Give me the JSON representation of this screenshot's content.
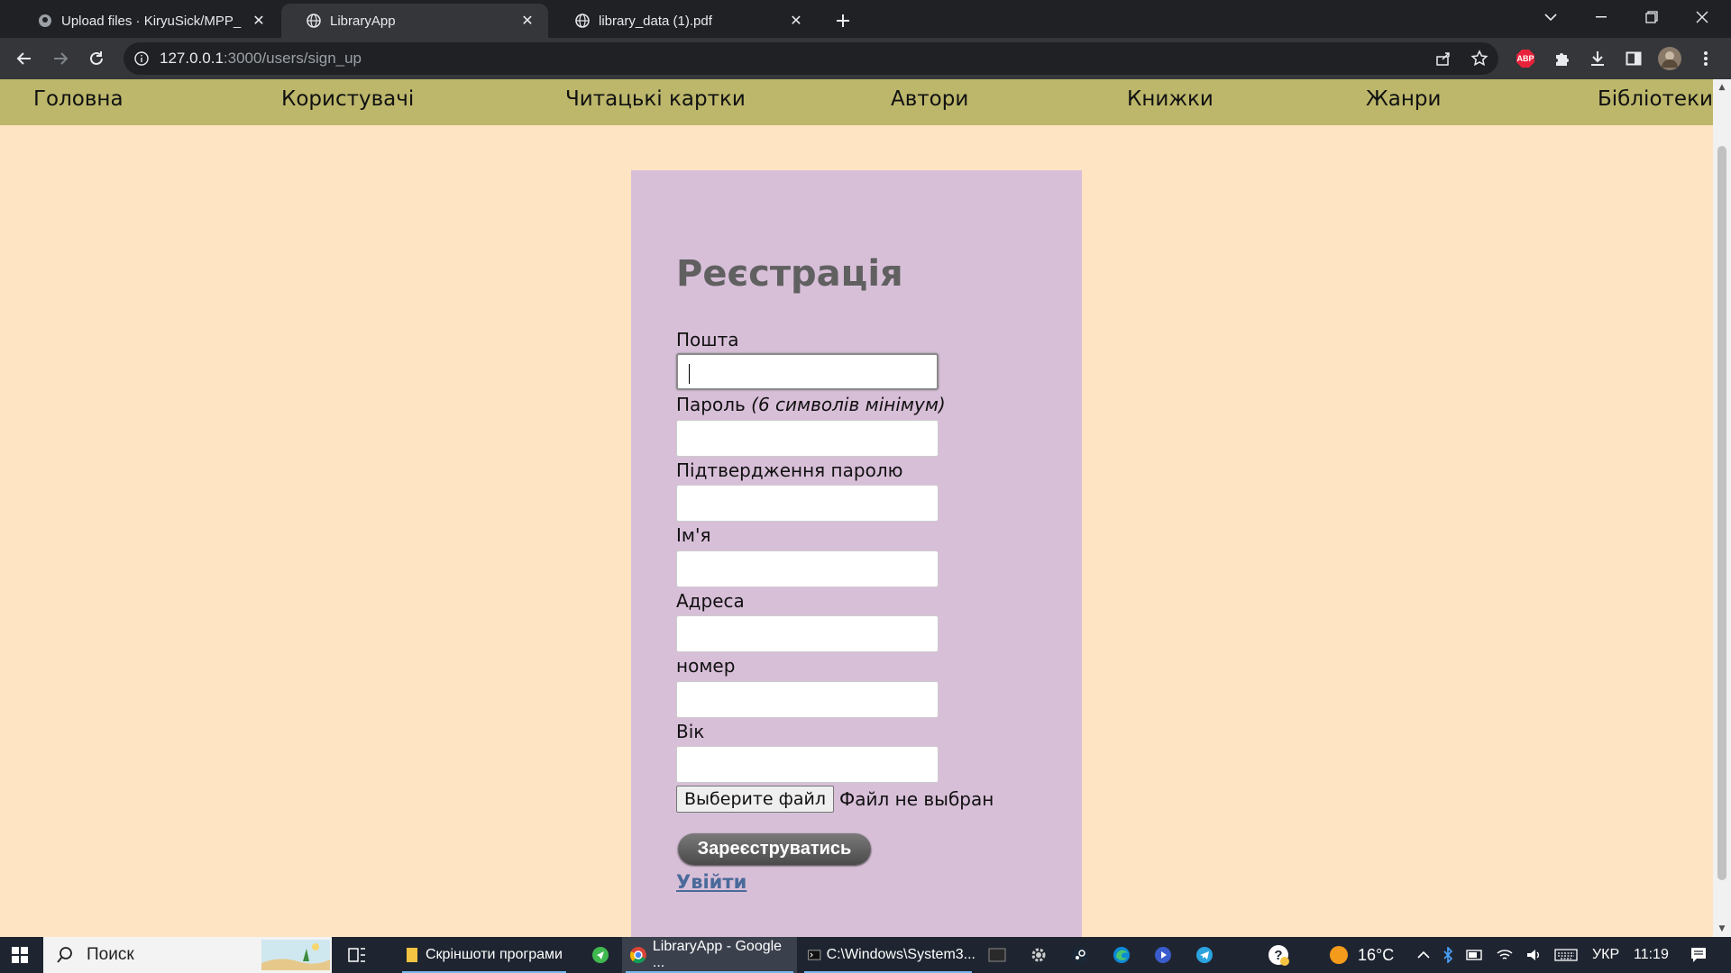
{
  "browser": {
    "tabs": [
      {
        "title": "Upload files · KiryuSick/MPP_Fin",
        "active": false
      },
      {
        "title": "LibraryApp",
        "active": true
      },
      {
        "title": "library_data (1).pdf",
        "active": false
      }
    ],
    "url_host": "127.0.0.1",
    "url_path": ":3000/users/sign_up",
    "extension_badge": "ABP"
  },
  "nav": {
    "items": [
      "Головна",
      "Користувачі",
      "Читацькі картки",
      "Автори",
      "Книжки",
      "Жанри",
      "Бібліотеки"
    ]
  },
  "form": {
    "title": "Реєстрація",
    "email_label": "Пошта",
    "password_label": "Пароль",
    "password_hint": "(6 символів мінімум)",
    "password_confirm_label": "Підтвердження паролю",
    "name_label": "Ім'я",
    "address_label": "Адреса",
    "phone_label": "номер",
    "age_label": "Вік",
    "file_button": "Выберите файл",
    "file_status": "Файл не выбран",
    "submit": "Зареєструватись",
    "login_link": "Увійти"
  },
  "taskbar": {
    "search_placeholder": "Поиск",
    "apps": [
      {
        "label": "Скріншоти програми"
      },
      {
        "label": "LibraryApp - Google ..."
      },
      {
        "label": "C:\\Windows\\System3..."
      }
    ],
    "weather": "16°C",
    "language": "УКР",
    "time": "11:19"
  },
  "colors": {
    "nav_bg": "#bdb76b",
    "page_bg": "#ffe4c4",
    "card_bg": "#d8bfd8",
    "link": "#4a6a9a"
  }
}
